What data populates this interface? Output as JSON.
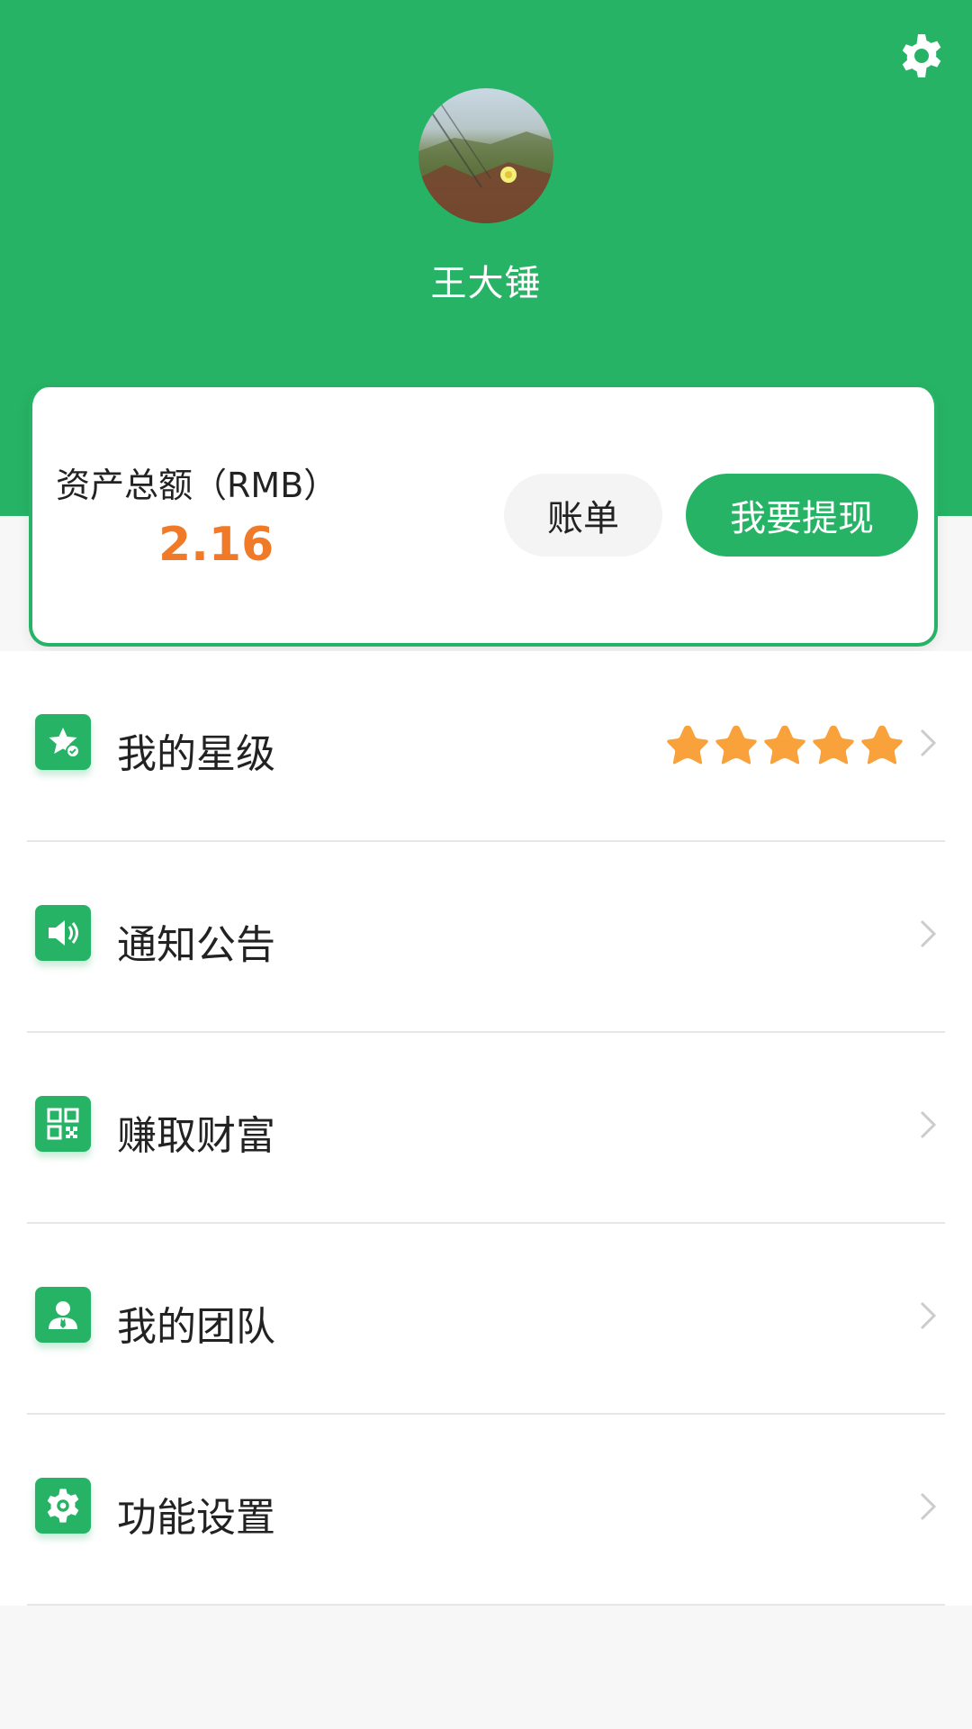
{
  "profile": {
    "username": "王大锤",
    "avatar_icon": "avatar-photo"
  },
  "header": {
    "settings_icon": "gear-icon",
    "background_color": "#27b366"
  },
  "assets": {
    "label": "资产总额（RMB）",
    "value": "2.16",
    "value_color": "#f07a28",
    "bill_button": "账单",
    "withdraw_button": "我要提现"
  },
  "menu": {
    "items": [
      {
        "label": "我的星级",
        "icon": "star-badge-icon",
        "stars": 5
      },
      {
        "label": "通知公告",
        "icon": "speaker-icon"
      },
      {
        "label": "赚取财富",
        "icon": "qr-code-icon"
      },
      {
        "label": "我的团队",
        "icon": "user-icon"
      },
      {
        "label": "功能设置",
        "icon": "gear-icon"
      }
    ]
  },
  "colors": {
    "accent": "#27b366",
    "star": "#f9a13a",
    "chevron": "#cccccc"
  }
}
